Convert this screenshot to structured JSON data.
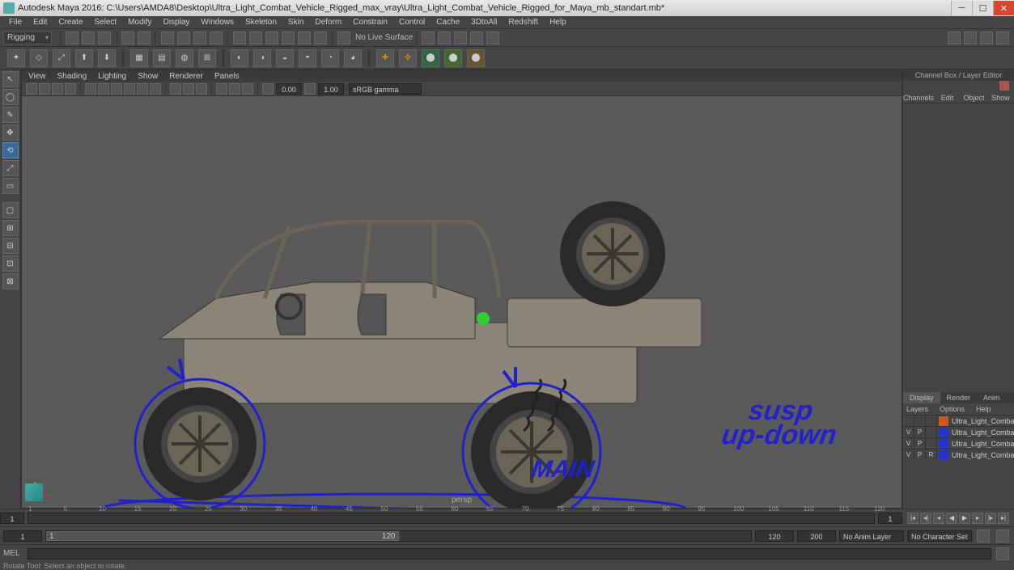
{
  "app": {
    "title": "Autodesk Maya 2016: C:\\Users\\AMDA8\\Desktop\\Ultra_Light_Combat_Vehicle_Rigged_max_vray\\Ultra_Light_Combat_Vehicle_Rigged_for_Maya_mb_standart.mb*"
  },
  "menus": [
    "File",
    "Edit",
    "Create",
    "Select",
    "Modify",
    "Display",
    "Windows",
    "Skeleton",
    "Skin",
    "Deform",
    "Constrain",
    "Control",
    "Cache",
    "3DtoAll",
    "Redshift",
    "Help"
  ],
  "moduleSelector": "Rigging",
  "noLiveSurface": "No Live Surface",
  "viewportMenus": [
    "View",
    "Shading",
    "Lighting",
    "Show",
    "Renderer",
    "Panels"
  ],
  "viewportNums": {
    "a": "0.00",
    "b": "1.00"
  },
  "colorSpace": "sRGB gamma",
  "cameraLabel": "persp",
  "channelBox": {
    "title": "Channel Box / Layer Editor",
    "tabs": [
      "Channels",
      "Edit",
      "Object",
      "Show"
    ],
    "subTabs": [
      "Display",
      "Render",
      "Anim"
    ],
    "activeSubTab": "Display",
    "layerMenus": [
      "Layers",
      "Options",
      "Help"
    ],
    "layers": [
      {
        "v": "",
        "p": "",
        "r": "",
        "color": "#cc5522",
        "name": "Ultra_Light_Combat_V"
      },
      {
        "v": "V",
        "p": "P",
        "r": "",
        "color": "#2233cc",
        "name": "Ultra_Light_Combat_V"
      },
      {
        "v": "V",
        "p": "P",
        "r": "",
        "color": "#2233cc",
        "name": "Ultra_Light_Combat_V"
      },
      {
        "v": "V",
        "p": "P",
        "r": "R",
        "color": "#2233cc",
        "name": "Ultra_Light_Combat_V"
      }
    ]
  },
  "timeSlider": {
    "ticks": [
      "1",
      "5",
      "10",
      "15",
      "20",
      "25",
      "30",
      "35",
      "40",
      "45",
      "50",
      "55",
      "60",
      "65",
      "70",
      "75",
      "80",
      "85",
      "90",
      "95",
      "100",
      "105",
      "110",
      "115",
      "120"
    ],
    "current": "1"
  },
  "rangeSlider": {
    "start": "1",
    "innerStart": "1",
    "innerEnd": "120",
    "end": "120",
    "outerEnd": "200"
  },
  "animLayer": "No Anim Layer",
  "charSet": "No Character Set",
  "cmd": {
    "label": "MEL"
  },
  "helpLine": "Rotate Tool: Select an object to rotate.",
  "rigLabels": {
    "susp": "susp",
    "updown": "up-down",
    "main": "MAIN"
  }
}
